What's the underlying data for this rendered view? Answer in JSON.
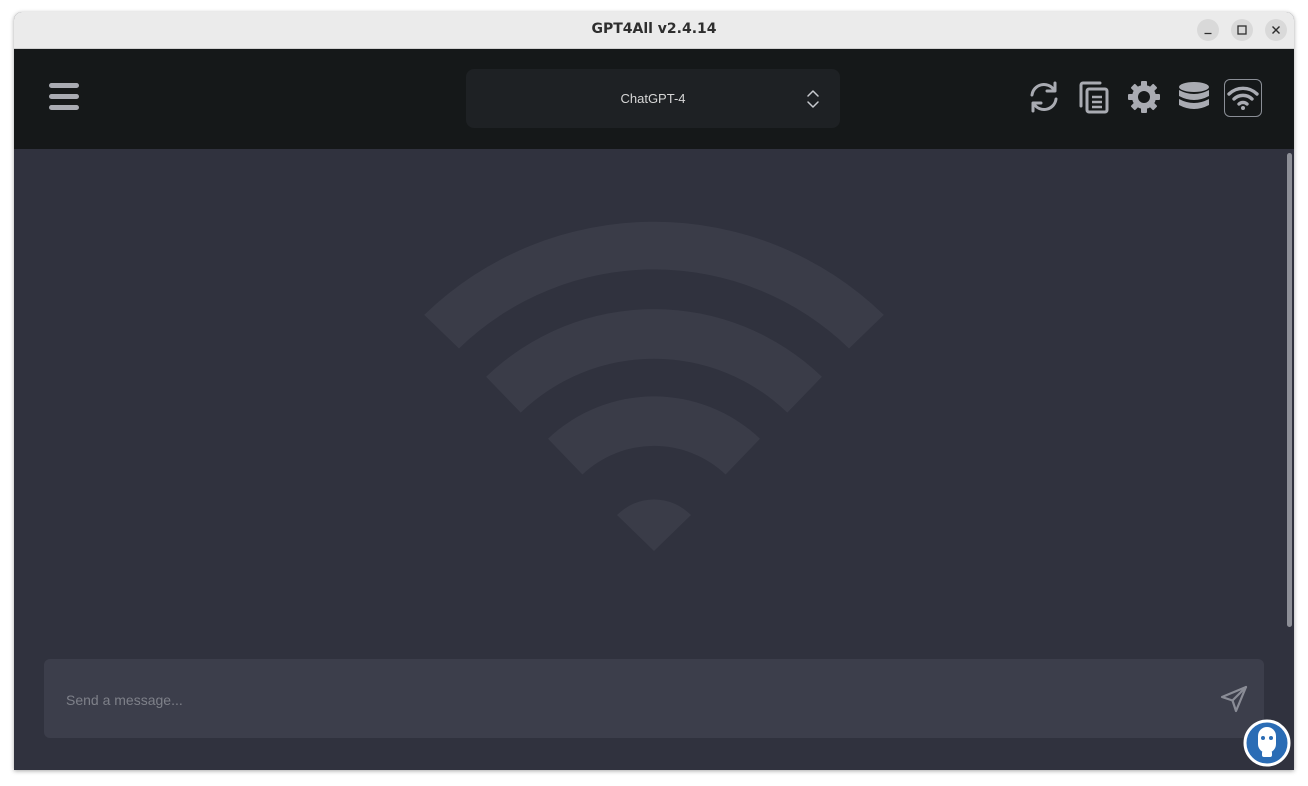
{
  "window": {
    "title": "GPT4All v2.4.14"
  },
  "header": {
    "model_selector": {
      "selected": "ChatGPT-4"
    },
    "icons": [
      "menu-icon",
      "refresh-icon",
      "copy-icon",
      "settings-icon",
      "database-icon",
      "network-icon"
    ]
  },
  "main": {
    "background_icon": "network-icon",
    "input": {
      "placeholder": "Send a message..."
    }
  },
  "colors": {
    "header_bg": "#151819",
    "content_bg": "#30323e",
    "input_bg": "#3c3e4b",
    "icon": "#a9abb2",
    "watermark_blue": "#2a6cb5"
  }
}
